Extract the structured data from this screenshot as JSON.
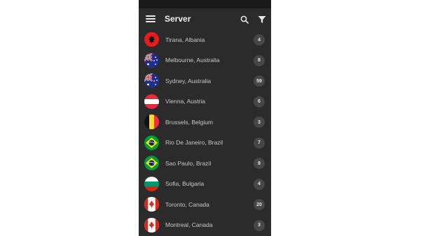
{
  "header": {
    "title": "Server",
    "menu_icon": "menu-icon",
    "search_icon": "search-icon",
    "filter_icon": "filter-icon"
  },
  "colors": {
    "background": "#2b2b2b",
    "status_bar": "#1a1a1a",
    "badge": "#474747",
    "text": "#c9c9c9"
  },
  "servers": [
    {
      "city": "Tirana, Albania",
      "count": "4",
      "flag": "albania-flag-icon"
    },
    {
      "city": "Melbourne, Australia",
      "count": "8",
      "flag": "australia-flag-icon"
    },
    {
      "city": "Sydney, Australia",
      "count": "59",
      "flag": "australia-flag-icon"
    },
    {
      "city": "Vienna, Austria",
      "count": "6",
      "flag": "austria-flag-icon"
    },
    {
      "city": "Brussels, Belgium",
      "count": "3",
      "flag": "belgium-flag-icon"
    },
    {
      "city": "Rio De Janeiro, Brazil",
      "count": "7",
      "flag": "brazil-flag-icon"
    },
    {
      "city": "Sao Paulo, Brazil",
      "count": "9",
      "flag": "brazil-flag-icon"
    },
    {
      "city": "Sofia, Bulgaria",
      "count": "4",
      "flag": "bulgaria-flag-icon"
    },
    {
      "city": "Toronto, Canada",
      "count": "20",
      "flag": "canada-flag-icon"
    },
    {
      "city": "Montreal, Canada",
      "count": "3",
      "flag": "canada-flag-icon"
    }
  ]
}
